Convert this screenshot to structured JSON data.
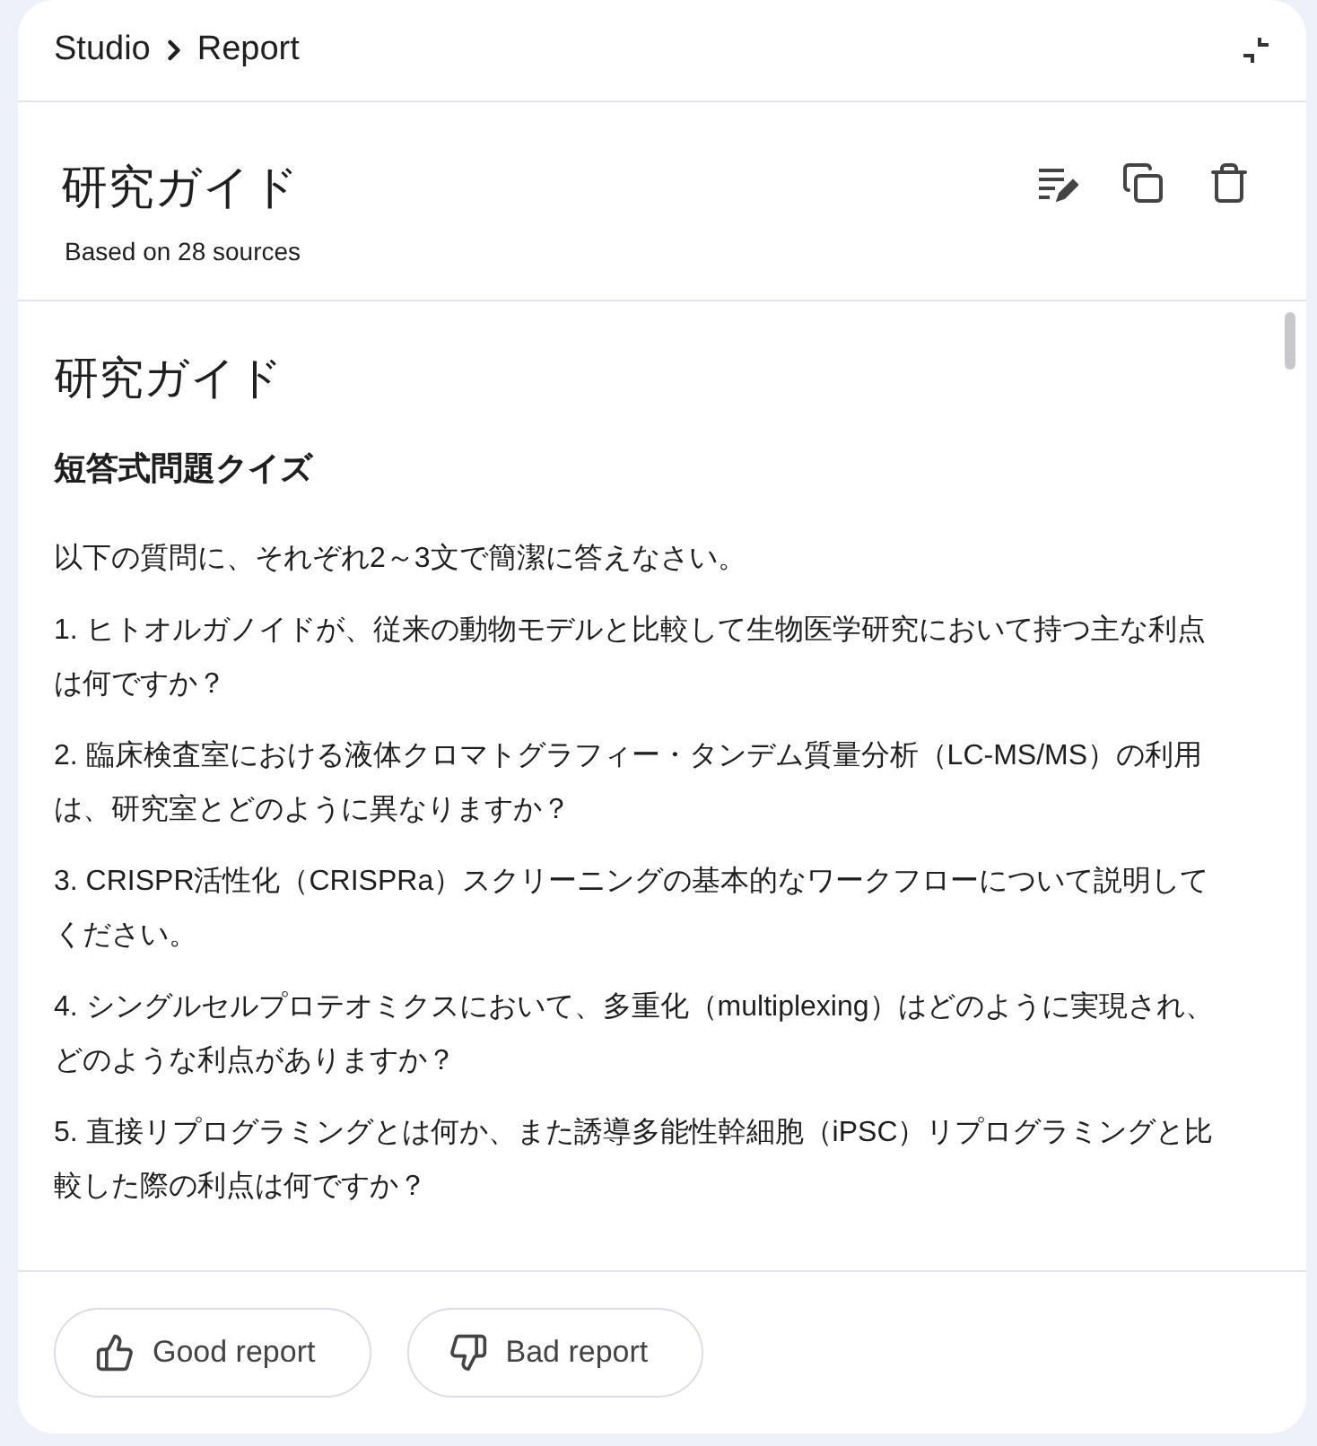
{
  "breadcrumb": [
    "Studio",
    "Report"
  ],
  "header": {
    "title": "研究ガイド",
    "subtitle": "Based on 28 sources"
  },
  "document": {
    "title": "研究ガイド",
    "section": "短答式問題クイズ",
    "paragraphs": [
      "以下の質問に、それぞれ2～3文で簡潔に答えなさい。",
      "1. ヒトオルガノイドが、従来の動物モデルと比較して生物医学研究において持つ主な利点は何ですか？",
      "2. 臨床検査室における液体クロマトグラフィー・タンデム質量分析（LC-MS/MS）の利用は、研究室とどのように異なりますか？",
      "3. CRISPR活性化（CRISPRa）スクリーニングの基本的なワークフローについて説明してください。",
      "4. シングルセルプロテオミクスにおいて、多重化（multiplexing）はどのように実現され、どのような利点がありますか？",
      "5. 直接リプログラミングとは何か、また誘導多能性幹細胞（iPSC）リプログラミングと比較した際の利点は何ですか？"
    ]
  },
  "feedback": [
    {
      "label": "Good report",
      "kind": "good"
    },
    {
      "label": "Bad report",
      "kind": "bad"
    }
  ]
}
